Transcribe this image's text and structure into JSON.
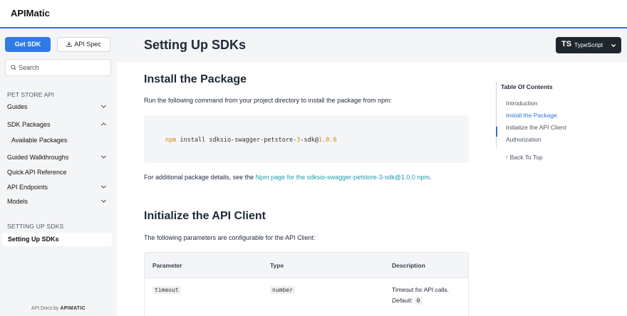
{
  "brand": "APIMatic",
  "sidebar": {
    "get_sdk": "Get SDK",
    "api_spec": "API Spec",
    "search_placeholder": "Search",
    "section_api": "PET STORE API",
    "items": [
      {
        "label": "Guides",
        "expanded": false
      },
      {
        "label": "SDK Packages",
        "expanded": true
      },
      {
        "label": "Available Packages"
      },
      {
        "label": "Guided Walkthroughs",
        "expanded": false
      },
      {
        "label": "Quick API Reference"
      },
      {
        "label": "API Endpoints",
        "expanded": false
      },
      {
        "label": "Models",
        "expanded": false
      }
    ],
    "section_setup": "SETTING UP SDKS",
    "active_item": "Setting Up SDKs",
    "footer_prefix": "API Docs by",
    "footer_brand": "APIMATIC"
  },
  "header": {
    "title": "Setting Up SDKs",
    "lang_badge": "TS",
    "lang_label": "TypeScript"
  },
  "content": {
    "install_heading": "Install the Package",
    "install_text": "Run the following command from your project directory to install the package from npm:",
    "code": {
      "cmd": "npm",
      "rest_before": " install sdksio-swagger-petstore-",
      "num1": "3",
      "rest_mid": "-sdk@",
      "version": "1.0.0"
    },
    "additional_prefix": "For additional package details, see the ",
    "npm_link": "Npm page for the sdksio-swagger-petstore-3-sdk@1.0.0 npm",
    "additional_suffix": ".",
    "init_heading": "Initialize the API Client",
    "init_text": "The following parameters are configurable for the API Client:",
    "table": {
      "headers": [
        "Parameter",
        "Type",
        "Description"
      ],
      "rows": [
        {
          "parameter": "timeout",
          "type": "number",
          "description": "Timeout for API calls.",
          "default_label": "Default:",
          "default_value": "0"
        }
      ]
    }
  },
  "toc": {
    "title": "Table Of Contents",
    "items": [
      "Introduction",
      "Install the Package",
      "Initialize the API Client",
      "Authorization"
    ],
    "active_index": 1,
    "back_to_top": "Back To Top"
  },
  "colors": {
    "accent": "#2f7be6",
    "link": "#1f9bb0",
    "dark_button": "#20262e"
  }
}
